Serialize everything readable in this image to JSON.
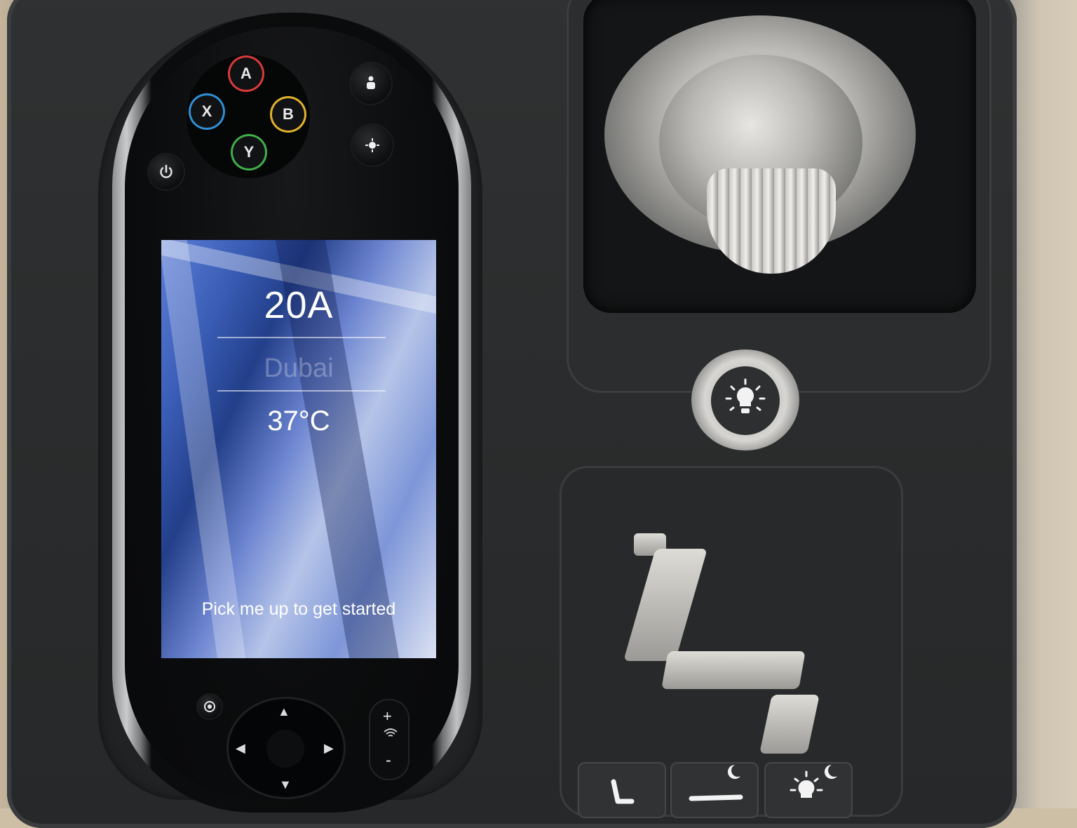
{
  "screen": {
    "seat_number": "20A",
    "city": "Dubai",
    "temperature": "37°C",
    "prompt": "Pick me up to get started"
  },
  "game_buttons": [
    {
      "label": "A",
      "ring_color": "#d93a3a"
    },
    {
      "label": "B",
      "ring_color": "#e0b22b"
    },
    {
      "label": "X",
      "ring_color": "#2f8fd6"
    },
    {
      "label": "Y",
      "ring_color": "#3fae4a"
    }
  ],
  "icons": {
    "power": "power-icon",
    "attendant_call": "attendant-call-icon",
    "reading_light": "reading-light-icon",
    "home": "home-icon",
    "volume_up": "+",
    "volume_down": "-",
    "dpad_up": "▲",
    "dpad_down": "▼",
    "dpad_left": "◀",
    "dpad_right": "▶"
  },
  "seat_controls": {
    "modes": [
      "upright",
      "bed-night",
      "light-night"
    ]
  }
}
